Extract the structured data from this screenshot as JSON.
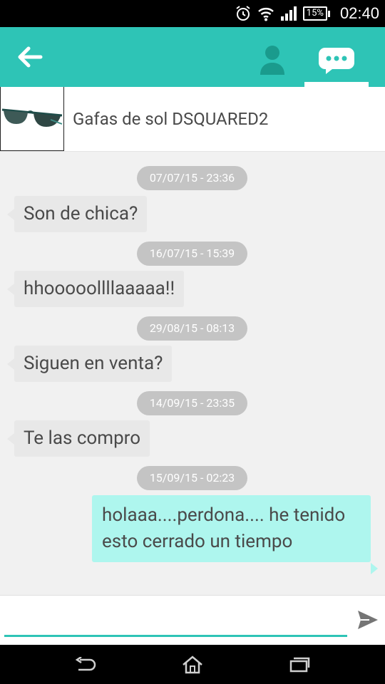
{
  "status_bar": {
    "time": "02:40",
    "battery": "15%",
    "icons": [
      "alarm-icon",
      "wifi-icon",
      "signal-icon",
      "battery-icon"
    ]
  },
  "action_bar": {
    "color": "#2ec4b6",
    "back_icon": "arrow-left-icon",
    "tabs": [
      {
        "name": "profile",
        "icon": "person-icon",
        "active": false
      },
      {
        "name": "chat",
        "icon": "chat-bubble-icon",
        "active": true
      }
    ]
  },
  "product": {
    "title": "Gafas de sol DSQUARED2",
    "thumbnail": "sunglasses-image"
  },
  "messages": [
    {
      "timestamp": "07/07/15 - 23:36",
      "text": "Son de chica?",
      "direction": "incoming"
    },
    {
      "timestamp": "16/07/15 - 15:39",
      "text": "hhooooollllaaaaa!!",
      "direction": "incoming"
    },
    {
      "timestamp": "29/08/15 - 08:13",
      "text": "Siguen en venta?",
      "direction": "incoming"
    },
    {
      "timestamp": "14/09/15 - 23:35",
      "text": "Te las compro",
      "direction": "incoming"
    },
    {
      "timestamp": "15/09/15 - 02:23",
      "text": "holaaa....perdona.... he tenido  esto cerrado un tiempo",
      "direction": "outgoing"
    }
  ],
  "input": {
    "value": "",
    "placeholder": "",
    "send_icon": "send-icon"
  },
  "nav_bar": {
    "icons": [
      "back-nav-icon",
      "home-icon",
      "recents-icon"
    ]
  }
}
